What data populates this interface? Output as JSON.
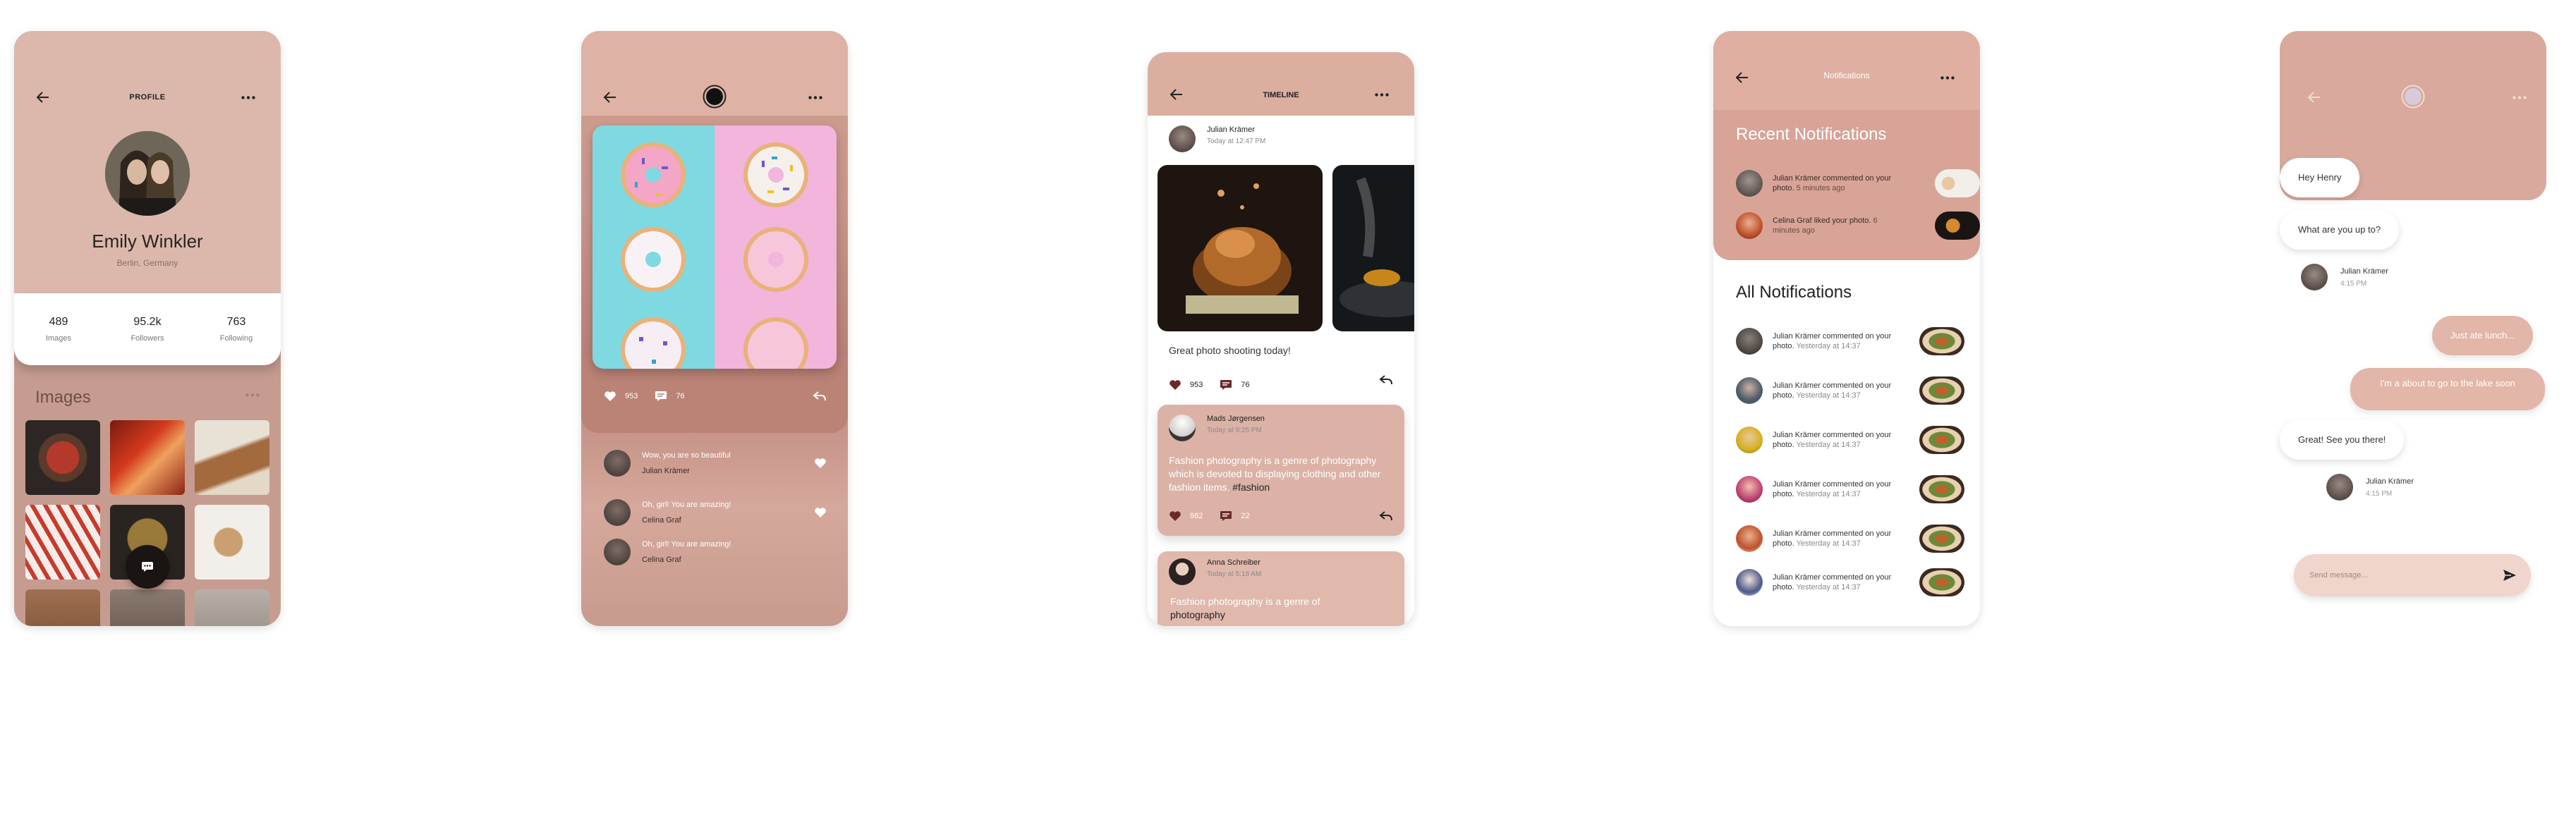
{
  "colors": {
    "accent": "#dcaea0",
    "accent_dark": "#c69c90",
    "heart": "#6b2a2a",
    "text_dark": "#222222"
  },
  "profile": {
    "title": "PROFILE",
    "name": "Emily Winkler",
    "location": "Berlin, Germany",
    "stats": [
      {
        "value": "489",
        "label": "Images"
      },
      {
        "value": "95.2k",
        "label": "Followers"
      },
      {
        "value": "763",
        "label": "Following"
      }
    ],
    "images_heading": "Images"
  },
  "post": {
    "likes": "953",
    "comments_count": "76",
    "comments": [
      {
        "text": "Wow, you are so beautiful",
        "author": "Julian Krämer"
      },
      {
        "text": "Oh, girl! You are amazing!",
        "author": "Celina Graf"
      },
      {
        "text": "Oh, girl! You are amazing!",
        "author": "Celina Graf"
      }
    ]
  },
  "timeline": {
    "title": "TIMELINE",
    "post1": {
      "author": "Julian Krämer",
      "time": "Today at 12:47 PM",
      "caption": "Great photo shooting today!",
      "likes": "953",
      "comments": "76"
    },
    "post2": {
      "author": "Mads Jørgensen",
      "time": "Today at 9:26 PM",
      "text": "Fashion photography is a genre of photography which is devoted to displaying clothing and other fashion items.",
      "tag": "#fashion",
      "likes": "982",
      "comments": "22"
    },
    "post3": {
      "author": "Anna Schreiber",
      "time": "Today at 5:18 AM",
      "text": "Fashion photography is a genre of",
      "text_bold": "photography"
    }
  },
  "notifications": {
    "title": "Notifications",
    "recent_heading": "Recent Notifications",
    "recent": [
      {
        "text": "Julian Krämer commented on your photo.",
        "ago": "5 minutes ago"
      },
      {
        "text": "Celina Graf liked your photo.",
        "ago": "6 minutes ago"
      }
    ],
    "all_heading": "All Notifications",
    "all": [
      {
        "text": "Julian Krämer commented on your photo.",
        "ago": "Yesterday at 14:37"
      },
      {
        "text": "Julian Krämer commented on your photo.",
        "ago": "Yesterday at 14:37"
      },
      {
        "text": "Julian Krämer commented on your photo.",
        "ago": "Yesterday at 14:37"
      },
      {
        "text": "Julian Krämer commented on your photo.",
        "ago": "Yesterday at 14:37"
      },
      {
        "text": "Julian Krämer commented on your photo.",
        "ago": "Yesterday at 14:37"
      },
      {
        "text": "Julian Krämer commented on your photo.",
        "ago": "Yesterday at 14:37"
      }
    ]
  },
  "chat": {
    "messages": [
      {
        "text": "Hey Henry",
        "side": "in"
      },
      {
        "text": "What are you up to?",
        "side": "in"
      },
      {
        "text": "Just ate lunch...",
        "side": "out"
      },
      {
        "text": "I'm a about to go to the lake soon",
        "side": "out"
      },
      {
        "text": "Great! See you there!",
        "side": "in"
      }
    ],
    "sender1": {
      "name": "Julian Krämer",
      "time": "4:15 PM"
    },
    "sender2": {
      "name": "Julian Krämer",
      "time": "4:15 PM"
    },
    "input_placeholder": "Send message..."
  }
}
